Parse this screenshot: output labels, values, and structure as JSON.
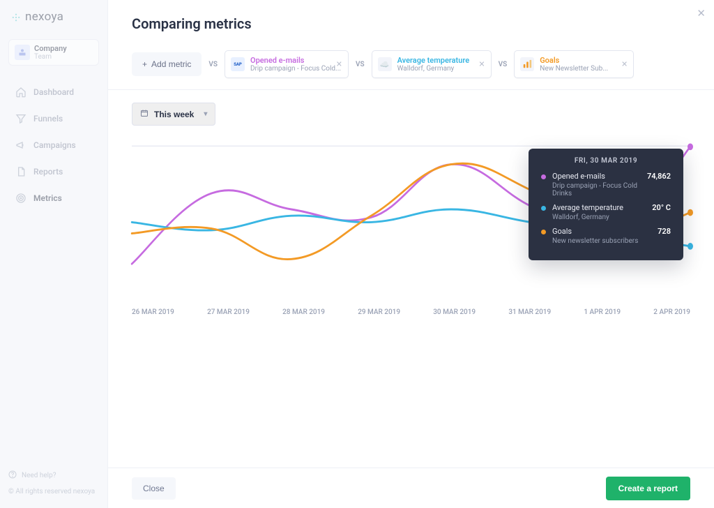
{
  "brand": {
    "name": "nexoya"
  },
  "sidebar": {
    "company_name": "Company",
    "company_sub": "Team",
    "items": [
      {
        "label": "Dashboard",
        "icon": "home-icon"
      },
      {
        "label": "Funnels",
        "icon": "funnel-icon"
      },
      {
        "label": "Campaigns",
        "icon": "megaphone-icon"
      },
      {
        "label": "Reports",
        "icon": "document-icon"
      },
      {
        "label": "Metrics",
        "icon": "target-icon"
      }
    ],
    "need_help": "Need help?",
    "copyright": "© All rights reserved nexoya"
  },
  "page": {
    "title": "Comparing metrics",
    "add_metric": "Add metric",
    "vs_label": "VS",
    "metrics": [
      {
        "title": "Opened e-mails",
        "subtitle": "Drip campaign - Focus Cold...",
        "icon": "sap-icon",
        "color": "#c66be0"
      },
      {
        "title": "Average temperature",
        "subtitle": "Walldorf, Germany",
        "icon": "weather-icon",
        "color": "#39b6e3"
      },
      {
        "title": "Goals",
        "subtitle": "New Newsletter Sub...",
        "icon": "bars-icon",
        "color": "#f39a25"
      }
    ],
    "timerange_label": "This week",
    "close_label": "Close",
    "create_report_label": "Create a report"
  },
  "tooltip": {
    "date": "FRI, 30 MAR 2019",
    "items": [
      {
        "dot": "#c66be0",
        "label": "Opened e-mails",
        "sub": "Drip campaign - Focus Cold Drinks",
        "value": "74,862"
      },
      {
        "dot": "#39b6e3",
        "label": "Average temperature",
        "sub": "Walldorf, Germany",
        "value": "20° C"
      },
      {
        "dot": "#f39a25",
        "label": "Goals",
        "sub": "New newsletter subscribers",
        "value": "728"
      }
    ]
  },
  "chart_data": {
    "type": "line",
    "categories": [
      "26 MAR 2019",
      "27 MAR 2019",
      "28 MAR 2019",
      "29 MAR 2019",
      "30 MAR 2019",
      "31 MAR 2019",
      "1 APR 2019",
      "2 APR 2019"
    ],
    "series": [
      {
        "name": "Opened e-mails (normalized)",
        "color": "#c66be0",
        "values": [
          26,
          70,
          60,
          55,
          88,
          62,
          40,
          99
        ]
      },
      {
        "name": "Average temperature (normalized)",
        "color": "#39b6e3",
        "values": [
          52,
          47,
          56,
          52,
          60,
          52,
          45,
          37
        ]
      },
      {
        "name": "Goals (normalized)",
        "color": "#f39a25",
        "values": [
          45,
          48,
          29,
          56,
          88,
          72,
          42,
          58
        ]
      }
    ],
    "ylim": [
      0,
      100
    ],
    "note": "Values are relative positions (0=bottom,100=top) read from the chart; each series uses its own scale so only shape is comparable."
  }
}
